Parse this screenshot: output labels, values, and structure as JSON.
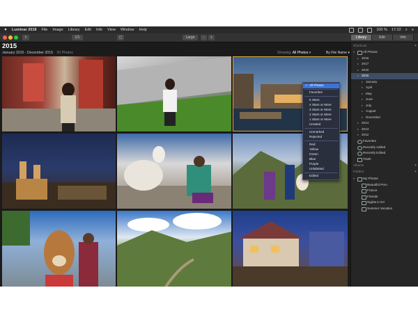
{
  "menubar": {
    "apple_icon": "apple-icon",
    "items": [
      "Luminar 2018",
      "File",
      "Image",
      "Library",
      "Edit",
      "Info",
      "View",
      "Window",
      "Help"
    ],
    "battery": "100 %",
    "time": "17:22"
  },
  "toolbar": {
    "view_button": "1/1",
    "zoom_select": "Large",
    "zoom_out": "−",
    "zoom_in": "+",
    "tabs": [
      "Library",
      "Edit",
      "Info"
    ],
    "active_tab": "Library"
  },
  "gallery": {
    "year": "2015",
    "date_range": "January 2015 - December 2015",
    "count": "20 Photos",
    "showing_label": "Showing:",
    "showing_value": "All Photos",
    "sort_label": "By File Name"
  },
  "dropdown": {
    "selected": "All Photos",
    "groups": [
      [
        "All Photos"
      ],
      [
        "Favorites"
      ],
      [
        "5 Stars",
        "4 Stars or More",
        "3 Stars or More",
        "2 Stars or More",
        "1 Stars or More",
        "Unrated"
      ],
      [
        "Unmarked",
        "Rejected"
      ],
      [
        "Red",
        "Yellow",
        "Green",
        "Blue",
        "Purple",
        "Unlabeled"
      ],
      [
        "Edited"
      ]
    ]
  },
  "sidebar": {
    "shortcuts_header": "Shortcuts",
    "all_photos": "All Photos",
    "years": [
      "2018",
      "2017",
      "2016",
      "2015"
    ],
    "months": [
      "January",
      "April",
      "May",
      "June",
      "July",
      "August",
      "December"
    ],
    "older_years": [
      "2014",
      "2013",
      "2012"
    ],
    "favorites": "Favorites",
    "recently_added": "Recently Added",
    "recently_edited": "Recently Edited",
    "trash": "Trash",
    "albums_header": "Albums",
    "folders_header": "Folders",
    "my_photos": "My Photos",
    "folders": [
      "Beautiful Peru",
      "France",
      "Friends",
      "Nights in NY",
      "Summer Vacation"
    ],
    "selected_year": "2015"
  },
  "colors": {
    "accent": "#3b73d8",
    "selection_border": "#e0a93a",
    "background": "#1e1e1e"
  }
}
